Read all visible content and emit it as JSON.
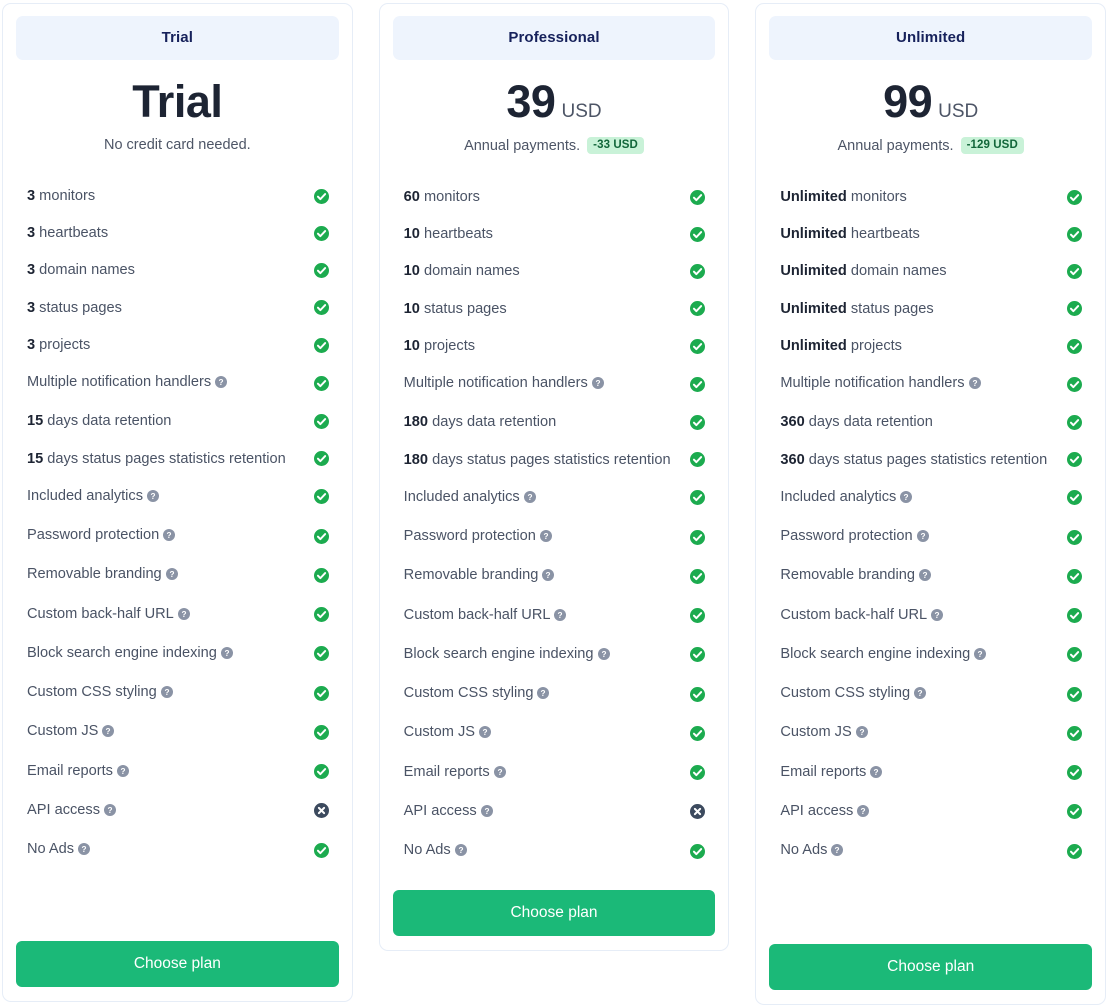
{
  "plans": [
    {
      "id": "trial",
      "header": "Trial",
      "price_amount": "Trial",
      "price_currency": "",
      "price_note": "No credit card needed.",
      "discount_badge": "",
      "cta": "Choose plan",
      "features": [
        {
          "accent": "3",
          "text": " monitors",
          "help": false,
          "status": "check"
        },
        {
          "accent": "3",
          "text": " heartbeats",
          "help": false,
          "status": "check"
        },
        {
          "accent": "3",
          "text": " domain names",
          "help": false,
          "status": "check"
        },
        {
          "accent": "3",
          "text": " status pages",
          "help": false,
          "status": "check"
        },
        {
          "accent": "3",
          "text": " projects",
          "help": false,
          "status": "check"
        },
        {
          "accent": "",
          "text": "Multiple notification handlers",
          "help": true,
          "status": "check"
        },
        {
          "accent": "15",
          "text": " days data retention",
          "help": false,
          "status": "check"
        },
        {
          "accent": "15",
          "text": " days status pages statistics retention",
          "help": false,
          "status": "check"
        },
        {
          "accent": "",
          "text": "Included analytics",
          "help": true,
          "status": "check"
        },
        {
          "accent": "",
          "text": "Password protection",
          "help": true,
          "status": "check"
        },
        {
          "accent": "",
          "text": "Removable branding",
          "help": true,
          "status": "check"
        },
        {
          "accent": "",
          "text": "Custom back-half URL",
          "help": true,
          "status": "check"
        },
        {
          "accent": "",
          "text": "Block search engine indexing",
          "help": true,
          "status": "check"
        },
        {
          "accent": "",
          "text": "Custom CSS styling",
          "help": true,
          "status": "check"
        },
        {
          "accent": "",
          "text": "Custom JS",
          "help": true,
          "status": "check"
        },
        {
          "accent": "",
          "text": "Email reports",
          "help": true,
          "status": "check"
        },
        {
          "accent": "",
          "text": "API access",
          "help": true,
          "status": "cross"
        },
        {
          "accent": "",
          "text": "No Ads",
          "help": true,
          "status": "check"
        }
      ]
    },
    {
      "id": "professional",
      "header": "Professional",
      "price_amount": "39",
      "price_currency": "USD",
      "price_note": "Annual payments.",
      "discount_badge": "-33 USD",
      "cta": "Choose plan",
      "features": [
        {
          "accent": "60",
          "text": " monitors",
          "help": false,
          "status": "check"
        },
        {
          "accent": "10",
          "text": " heartbeats",
          "help": false,
          "status": "check"
        },
        {
          "accent": "10",
          "text": " domain names",
          "help": false,
          "status": "check"
        },
        {
          "accent": "10",
          "text": " status pages",
          "help": false,
          "status": "check"
        },
        {
          "accent": "10",
          "text": " projects",
          "help": false,
          "status": "check"
        },
        {
          "accent": "",
          "text": "Multiple notification handlers",
          "help": true,
          "status": "check"
        },
        {
          "accent": "180",
          "text": " days data retention",
          "help": false,
          "status": "check"
        },
        {
          "accent": "180",
          "text": " days status pages statistics retention",
          "help": false,
          "status": "check"
        },
        {
          "accent": "",
          "text": "Included analytics",
          "help": true,
          "status": "check"
        },
        {
          "accent": "",
          "text": "Password protection",
          "help": true,
          "status": "check"
        },
        {
          "accent": "",
          "text": "Removable branding",
          "help": true,
          "status": "check"
        },
        {
          "accent": "",
          "text": "Custom back-half URL",
          "help": true,
          "status": "check"
        },
        {
          "accent": "",
          "text": "Block search engine indexing",
          "help": true,
          "status": "check"
        },
        {
          "accent": "",
          "text": "Custom CSS styling",
          "help": true,
          "status": "check"
        },
        {
          "accent": "",
          "text": "Custom JS",
          "help": true,
          "status": "check"
        },
        {
          "accent": "",
          "text": "Email reports",
          "help": true,
          "status": "check"
        },
        {
          "accent": "",
          "text": "API access",
          "help": true,
          "status": "cross"
        },
        {
          "accent": "",
          "text": "No Ads",
          "help": true,
          "status": "check"
        }
      ]
    },
    {
      "id": "unlimited",
      "header": "Unlimited",
      "price_amount": "99",
      "price_currency": "USD",
      "price_note": "Annual payments.",
      "discount_badge": "-129 USD",
      "cta": "Choose plan",
      "features": [
        {
          "accent": "Unlimited",
          "text": " monitors",
          "help": false,
          "status": "check"
        },
        {
          "accent": "Unlimited",
          "text": " heartbeats",
          "help": false,
          "status": "check"
        },
        {
          "accent": "Unlimited",
          "text": " domain names",
          "help": false,
          "status": "check"
        },
        {
          "accent": "Unlimited",
          "text": " status pages",
          "help": false,
          "status": "check"
        },
        {
          "accent": "Unlimited",
          "text": " projects",
          "help": false,
          "status": "check"
        },
        {
          "accent": "",
          "text": "Multiple notification handlers",
          "help": true,
          "status": "check"
        },
        {
          "accent": "360",
          "text": " days data retention",
          "help": false,
          "status": "check"
        },
        {
          "accent": "360",
          "text": " days status pages statistics retention",
          "help": false,
          "status": "check"
        },
        {
          "accent": "",
          "text": "Included analytics",
          "help": true,
          "status": "check"
        },
        {
          "accent": "",
          "text": "Password protection",
          "help": true,
          "status": "check"
        },
        {
          "accent": "",
          "text": "Removable branding",
          "help": true,
          "status": "check"
        },
        {
          "accent": "",
          "text": "Custom back-half URL",
          "help": true,
          "status": "check"
        },
        {
          "accent": "",
          "text": "Block search engine indexing",
          "help": true,
          "status": "check"
        },
        {
          "accent": "",
          "text": "Custom CSS styling",
          "help": true,
          "status": "check"
        },
        {
          "accent": "",
          "text": "Custom JS",
          "help": true,
          "status": "check"
        },
        {
          "accent": "",
          "text": "Email reports",
          "help": true,
          "status": "check"
        },
        {
          "accent": "",
          "text": "API access",
          "help": true,
          "status": "check"
        },
        {
          "accent": "",
          "text": "No Ads",
          "help": true,
          "status": "check"
        }
      ]
    }
  ],
  "icons": {
    "check": "check-circle-icon",
    "cross": "x-circle-icon",
    "help": "help-circle-icon"
  },
  "colors": {
    "check_green": "#1cab4f",
    "cross_dark": "#3c4a5e",
    "help_grey": "#8a93a5",
    "cta_green": "#1bb978",
    "header_band": "#eef4fd",
    "header_text": "#16215b",
    "badge_bg": "#c9f2d8",
    "badge_text": "#12663a"
  }
}
